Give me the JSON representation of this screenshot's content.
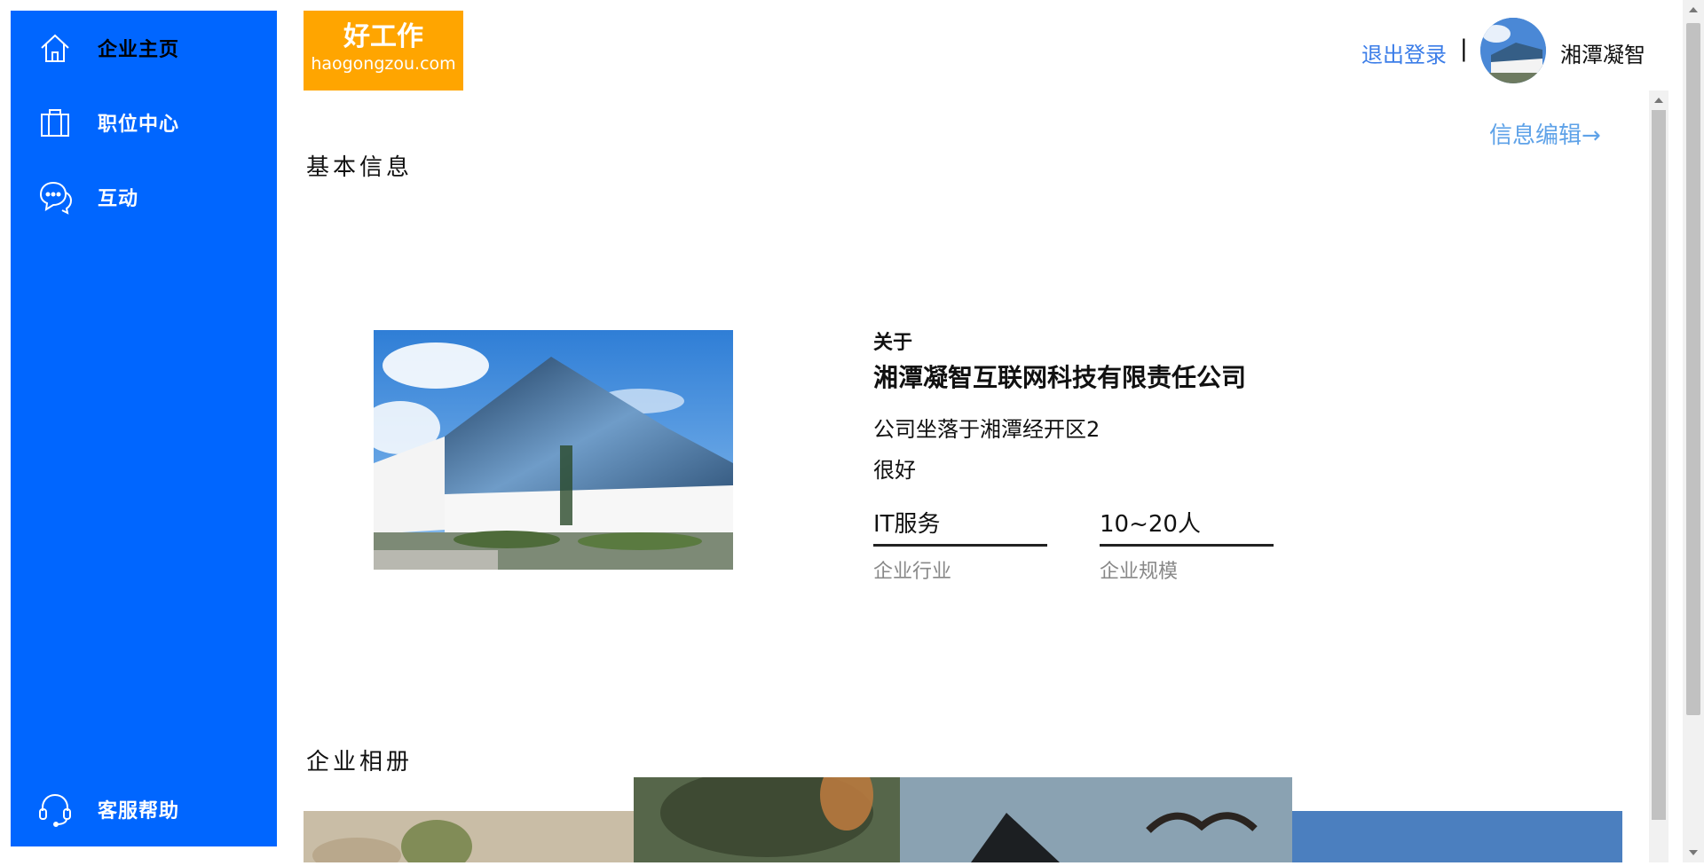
{
  "sidebar": {
    "items": [
      {
        "label": "企业主页",
        "icon": "home-icon"
      },
      {
        "label": "职位中心",
        "icon": "briefcase-icon"
      },
      {
        "label": "互动",
        "icon": "chat-icon"
      }
    ],
    "help": {
      "label": "客服帮助",
      "icon": "headset-icon"
    }
  },
  "logo": {
    "cn": "好工作",
    "en": "haogongzou.com"
  },
  "header": {
    "logout": "退出登录",
    "divider": "|",
    "username": "湘潭凝智"
  },
  "basic_info": {
    "title": "基本信息",
    "edit_link": "信息编辑→",
    "about_label": "关于",
    "company_name": "湘潭凝智互联网科技有限责任公司",
    "description": "公司坐落于湘潭经开区2",
    "extra": "很好",
    "industry_value": "IT服务",
    "industry_caption": "企业行业",
    "size_value": "10~20人",
    "size_caption": "企业规模"
  },
  "album": {
    "title": "企业相册"
  },
  "colors": {
    "sidebar": "#0066ff",
    "logo": "#ffa500",
    "link": "#3b7de8",
    "edit_link": "#5ea2e8"
  }
}
